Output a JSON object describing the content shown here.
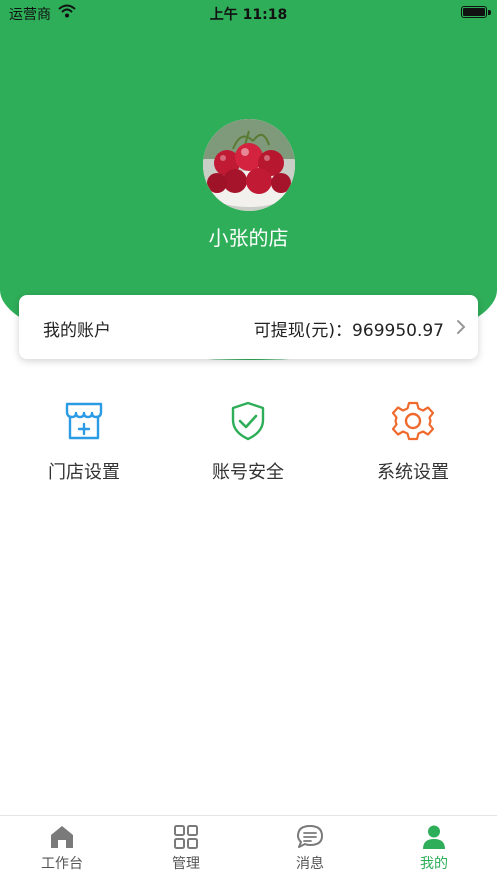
{
  "status_bar": {
    "carrier": "运营商",
    "time": "上午 11:18"
  },
  "profile": {
    "shop_name": "小张的店",
    "avatar_icon": "cherries-photo-icon"
  },
  "account": {
    "label": "我的账户",
    "balance_text": "可提现(元)：969950.97"
  },
  "menu": {
    "items": [
      {
        "label": "门店设置",
        "icon": "store-icon",
        "color": "#2a9be4"
      },
      {
        "label": "账号安全",
        "icon": "shield-check-icon",
        "color": "#2fae59"
      },
      {
        "label": "系统设置",
        "icon": "gear-icon",
        "color": "#f06a2e"
      }
    ]
  },
  "tabbar": {
    "items": [
      {
        "label": "工作台",
        "icon": "home-icon"
      },
      {
        "label": "管理",
        "icon": "grid-icon"
      },
      {
        "label": "消息",
        "icon": "chat-icon"
      },
      {
        "label": "我的",
        "icon": "user-icon",
        "active": true
      }
    ]
  },
  "colors": {
    "brand_green": "#2fae59",
    "inactive_gray": "#6b6b6b"
  }
}
